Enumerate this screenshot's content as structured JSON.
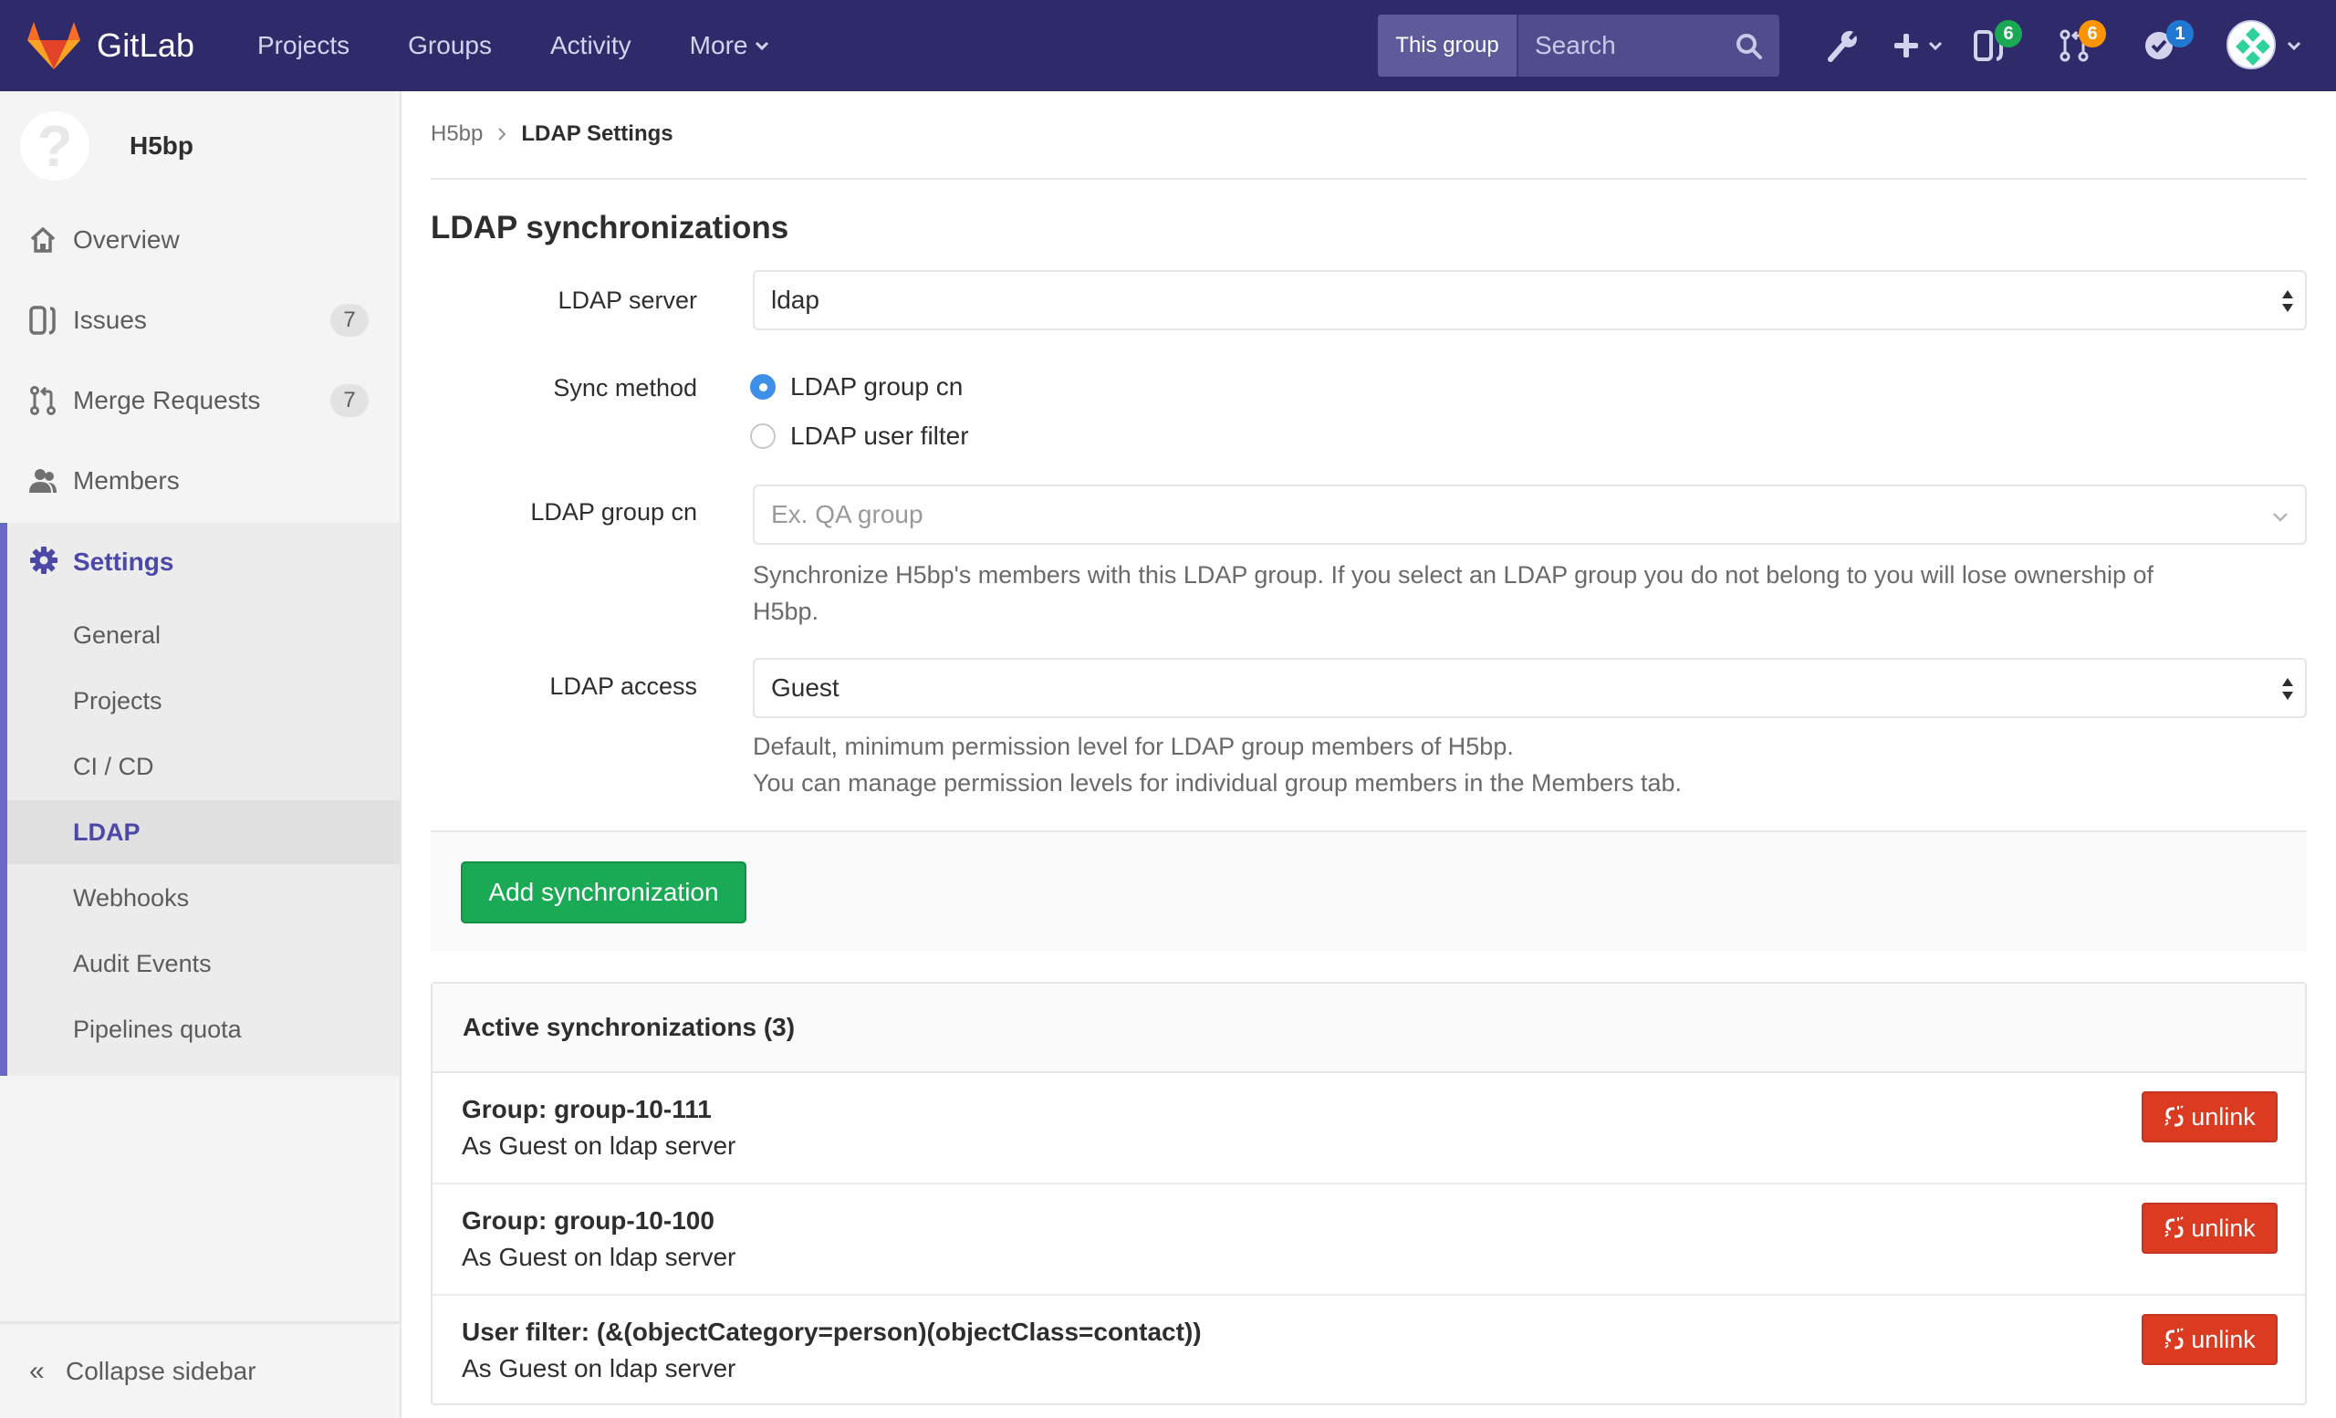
{
  "header": {
    "brand": "GitLab",
    "nav": [
      {
        "label": "Projects"
      },
      {
        "label": "Groups"
      },
      {
        "label": "Activity"
      },
      {
        "label": "More",
        "has_dropdown": true
      }
    ],
    "search": {
      "scope": "This group",
      "placeholder": "Search",
      "value": ""
    },
    "icons": [
      {
        "name": "admin-wrench-icon"
      },
      {
        "name": "new-plus-icon",
        "has_dropdown": true
      },
      {
        "name": "issues-icon",
        "badge": "6",
        "badge_color": "#1aaa55"
      },
      {
        "name": "merge-requests-icon",
        "badge": "6",
        "badge_color": "#fc9403"
      },
      {
        "name": "todos-icon",
        "badge": "1",
        "badge_color": "#1f78d1"
      },
      {
        "name": "user-avatar",
        "has_dropdown": true
      }
    ],
    "colors": {
      "bar": "#2f2b6a",
      "link": "#d4d3ee"
    }
  },
  "sidebar": {
    "context": {
      "name": "H5bp",
      "avatar_glyph": "?"
    },
    "items": [
      {
        "label": "Overview",
        "icon": "home-icon"
      },
      {
        "label": "Issues",
        "icon": "issues-icon",
        "count": "7"
      },
      {
        "label": "Merge Requests",
        "icon": "merge-request-icon",
        "count": "7"
      },
      {
        "label": "Members",
        "icon": "members-icon"
      }
    ],
    "settings": {
      "label": "Settings",
      "icon": "gear-icon",
      "sub_items": [
        {
          "label": "General"
        },
        {
          "label": "Projects"
        },
        {
          "label": "CI / CD"
        },
        {
          "label": "LDAP",
          "active": true
        },
        {
          "label": "Webhooks"
        },
        {
          "label": "Audit Events"
        },
        {
          "label": "Pipelines quota"
        }
      ]
    },
    "collapse_label": "Collapse sidebar",
    "collapse_glyph": "«",
    "accent": "#4b48a7"
  },
  "breadcrumb": {
    "parent": "H5bp",
    "current": "LDAP Settings"
  },
  "page": {
    "title": "LDAP synchronizations",
    "form": {
      "ldap_server": {
        "label": "LDAP server",
        "value": "ldap"
      },
      "sync_method": {
        "label": "Sync method",
        "options": [
          {
            "label": "LDAP group cn",
            "checked": true
          },
          {
            "label": "LDAP user filter",
            "checked": false
          }
        ]
      },
      "group_cn": {
        "label": "LDAP group cn",
        "placeholder": "Ex. QA group",
        "help_line1": "Synchronize H5bp's members with this LDAP group. If you select an LDAP group you do not belong to you will lose ownership of",
        "help_line2": "H5bp."
      },
      "ldap_access": {
        "label": "LDAP access",
        "value": "Guest",
        "help_line1": "Default, minimum permission level for LDAP group members of H5bp.",
        "help_line2": "You can manage permission levels for individual group members in the Members tab."
      },
      "submit_label": "Add synchronization"
    },
    "active_syncs": {
      "title": "Active synchronizations (3)",
      "rows": [
        {
          "title": "Group: group-10-111",
          "subtitle": "As Guest on ldap server",
          "action": "unlink"
        },
        {
          "title": "Group: group-10-100",
          "subtitle": "As Guest on ldap server",
          "action": "unlink"
        },
        {
          "title": "User filter: (&(objectCategory=person)(objectClass=contact))",
          "subtitle": "As Guest on ldap server",
          "action": "unlink"
        }
      ]
    }
  }
}
